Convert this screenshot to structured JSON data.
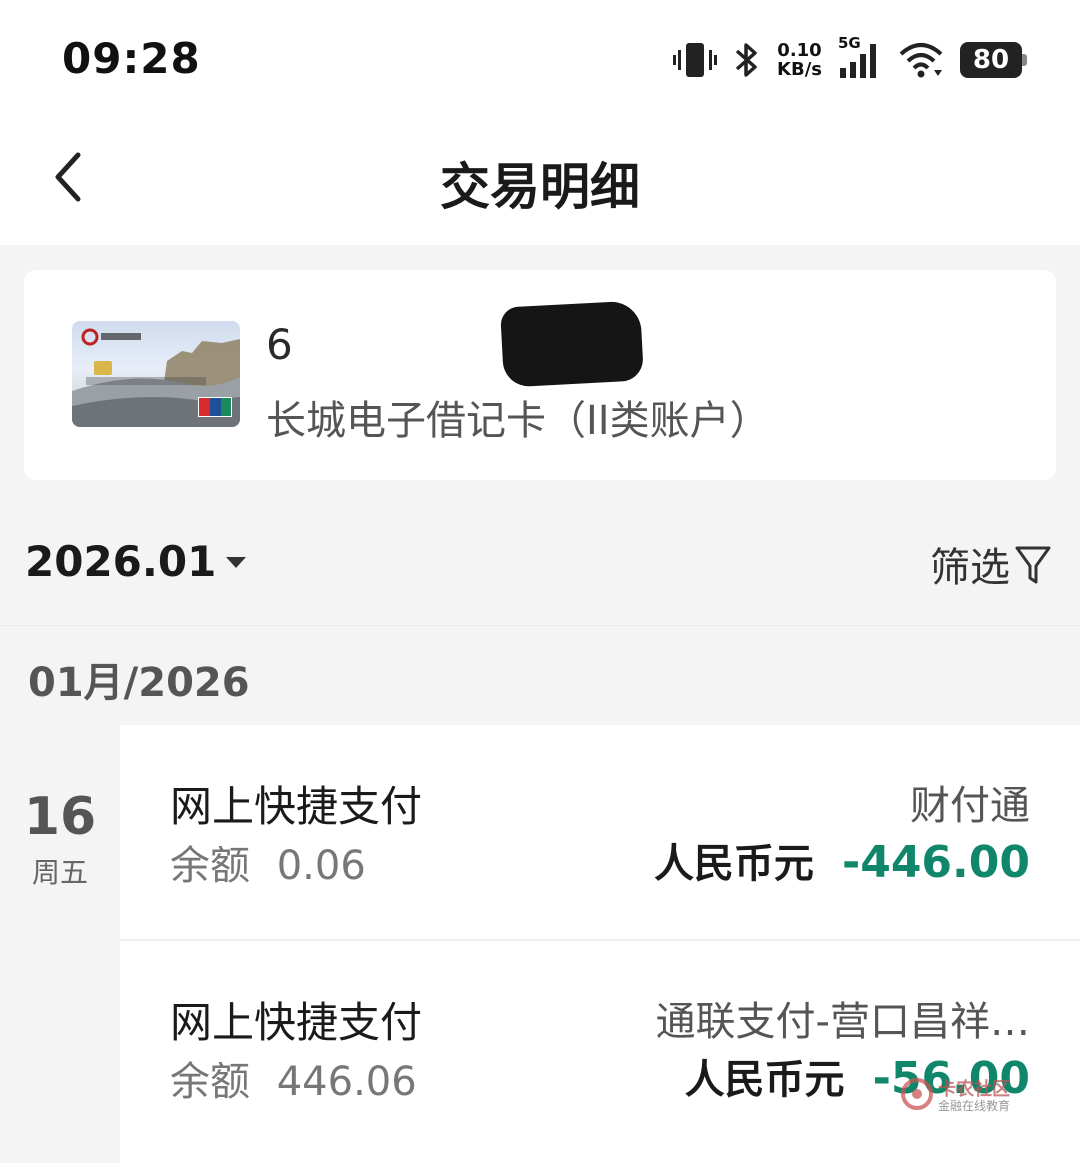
{
  "status_bar": {
    "time": "09:28",
    "net_speed_value": "0.10",
    "net_speed_unit": "KB/s",
    "network": "5G",
    "battery": "80",
    "icons": [
      "vibrate-icon",
      "bluetooth-icon",
      "signal-icon",
      "wifi-icon",
      "battery-icon"
    ]
  },
  "header": {
    "title": "交易明细"
  },
  "card": {
    "number_prefix": "6",
    "name": "长城电子借记卡（II类账户）"
  },
  "filter_bar": {
    "month": "2026.01",
    "filter_label": "筛选"
  },
  "group": {
    "label": "01月/2026"
  },
  "date": {
    "day": "16",
    "weekday": "周五"
  },
  "transactions": [
    {
      "title": "网上快捷支付",
      "balance_label": "余额",
      "balance": "0.06",
      "merchant": "财付通",
      "currency": "人民币元",
      "amount": "-446.00"
    },
    {
      "title": "网上快捷支付",
      "balance_label": "余额",
      "balance": "446.06",
      "merchant": "通联支付-营口昌祥…",
      "currency": "人民币元",
      "amount": "-56.00"
    }
  ],
  "watermark": {
    "title": "卡农社区",
    "subtitle": "金融在线教育"
  },
  "colors": {
    "amount": "#10866a",
    "background": "#f4f4f4",
    "surface": "#ffffff"
  }
}
